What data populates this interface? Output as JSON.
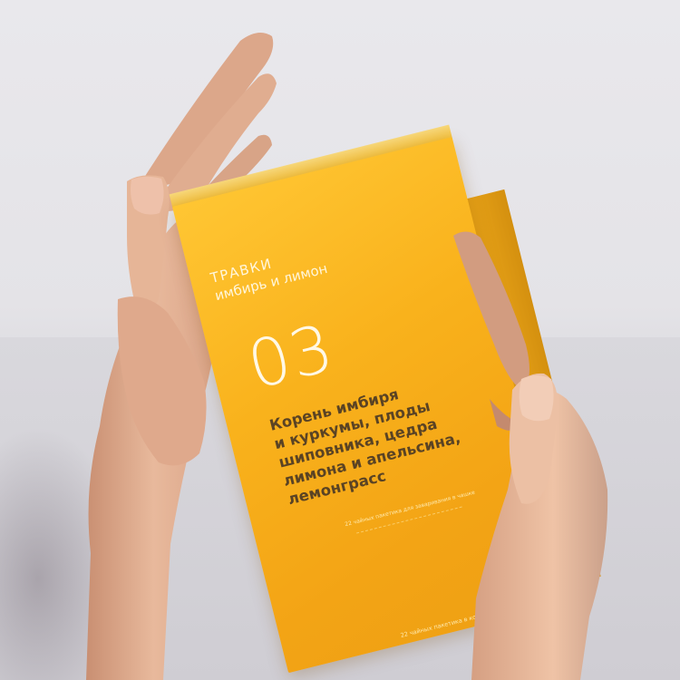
{
  "scene": {
    "description_colors": {
      "background": "#e6e5e9",
      "box": "#f9b21c",
      "ingredients_text": "#5a4324",
      "light_text": "#fff6dc"
    }
  },
  "package": {
    "brand": "ТРАВКИ",
    "flavor": "имбирь и лимон",
    "number": "03",
    "ingredients": [
      "Корень имбиря",
      "и куркумы, плоды",
      "шиповника, цедра",
      "лимона и апельсина,",
      "лемонграсс"
    ],
    "fine_print_middle": "22 чайных пакетика для заваривания в чашке",
    "fine_print_bottom": "22 чайных пакетика в конвертах"
  }
}
